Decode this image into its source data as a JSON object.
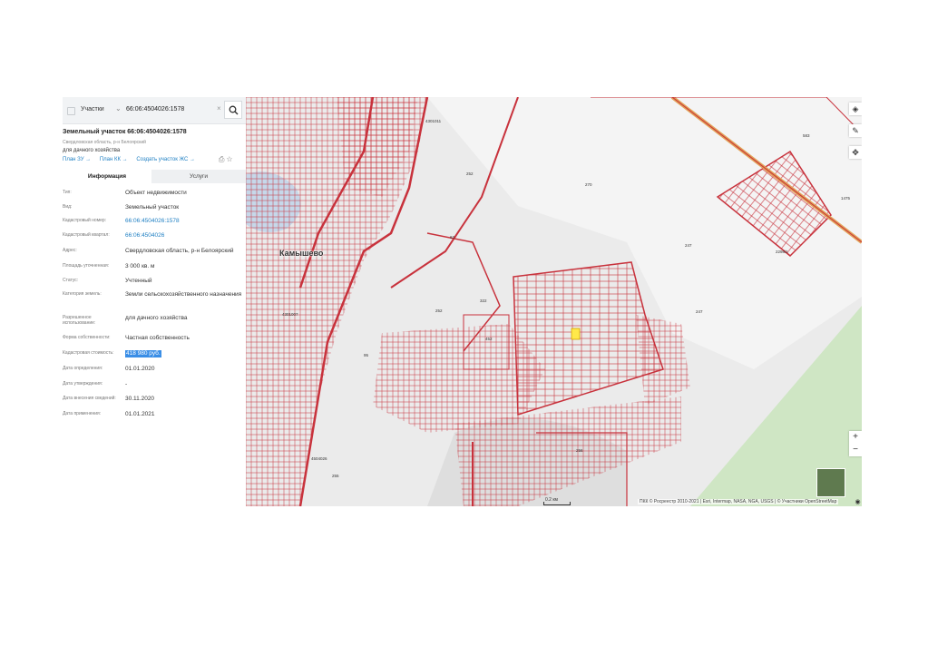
{
  "search": {
    "type": "Участки",
    "query": "66:06:4504026:1578"
  },
  "parcel": {
    "title": "Земельный участок 66:06:4504026:1578",
    "address_short": "Свердловская область, р-н Белоярский",
    "use": "для дачного хозяйства",
    "links": [
      "План ЗУ →",
      "План КК →",
      "Создать участок ЖС →"
    ]
  },
  "tabs": {
    "info": "Информация",
    "services": "Услуги"
  },
  "rows": [
    {
      "k": "Тип:",
      "v": "Объект недвижимости"
    },
    {
      "k": "Вид:",
      "v": "Земельный участок"
    },
    {
      "k": "Кадастровый номер:",
      "v": "66:06:4504026:1578"
    },
    {
      "k": "Кадастровый квартал:",
      "v": "66:06:4504026"
    },
    {
      "k": "Адрес:",
      "v": "Свердловская область, р-н Белоярский"
    },
    {
      "k": "Площадь уточненная:",
      "v": "3 000 кв. м"
    },
    {
      "k": "Статус:",
      "v": "Учтенный"
    },
    {
      "k": "Категория земель:",
      "v": "Земли сельскохозяйственного назначения"
    },
    {
      "k": "Разрешенное использование:",
      "v": "для дачного хозяйства"
    },
    {
      "k": "Форма собственности:",
      "v": "Частная собственность"
    },
    {
      "k": "Кадастровая стоимость:",
      "v": "418 980 руб."
    },
    {
      "k": "Дата определения:",
      "v": "01.01.2020"
    },
    {
      "k": "Дата утверждения:",
      "v": "-"
    },
    {
      "k": "Дата внесения сведений:",
      "v": "30.11.2020"
    },
    {
      "k": "Дата применения:",
      "v": "01.01.2021"
    }
  ],
  "map": {
    "town": "Камышево",
    "scale": "0.2 км",
    "attribution": "ПКК © Росреестр 2010-2021 | Esri, Intermap, NASA, NGA, USGS | © Участники OpenStreetMap",
    "labels": [
      "252",
      "270",
      "247",
      "247",
      "583",
      "1475",
      "2298/1",
      "322",
      "452",
      "252",
      "4301007",
      "4301011",
      "4504026",
      "256",
      "255",
      "63",
      "95"
    ],
    "zoom_in": "+",
    "zoom_out": "−",
    "layer_colors": {
      "parcel": "#c8323c",
      "forest": "#cfe6c4",
      "terrain": "#e8e8e8"
    }
  }
}
